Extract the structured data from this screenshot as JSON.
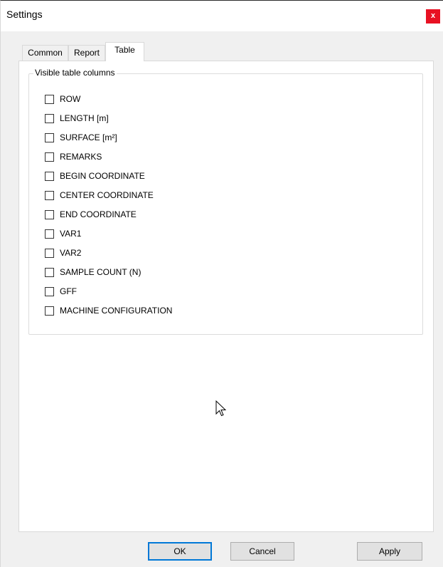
{
  "window": {
    "title": "Settings",
    "close_label": "x"
  },
  "tabs": [
    {
      "label": "Common",
      "selected": false
    },
    {
      "label": "Report",
      "selected": false
    },
    {
      "label": "Table",
      "selected": true
    }
  ],
  "group": {
    "legend": "Visible table columns",
    "columns": [
      {
        "label": "ROW",
        "checked": false
      },
      {
        "label": "LENGTH [m]",
        "checked": false
      },
      {
        "label": "SURFACE [m²]",
        "checked": false
      },
      {
        "label": "REMARKS",
        "checked": false
      },
      {
        "label": "BEGIN COORDINATE",
        "checked": false
      },
      {
        "label": "CENTER COORDINATE",
        "checked": false
      },
      {
        "label": "END COORDINATE",
        "checked": false
      },
      {
        "label": "VAR1",
        "checked": false
      },
      {
        "label": "VAR2",
        "checked": false
      },
      {
        "label": "SAMPLE COUNT (N)",
        "checked": false
      },
      {
        "label": "GFF",
        "checked": false
      },
      {
        "label": "MACHINE CONFIGURATION",
        "checked": false
      }
    ]
  },
  "buttons": {
    "ok": "OK",
    "cancel": "Cancel",
    "apply": "Apply"
  },
  "colors": {
    "close_button": "#e81123",
    "focus_border": "#0078d7",
    "dialog_background": "#f0f0f0"
  }
}
